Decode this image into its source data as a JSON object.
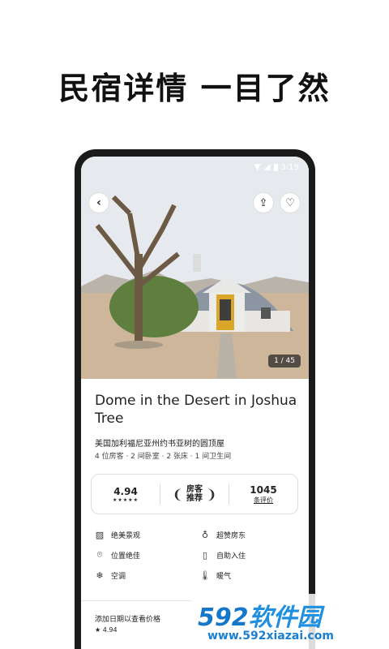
{
  "headline": "民宿详情 一目了然",
  "statusbar": {
    "time": "3:19"
  },
  "photo": {
    "counter": "1 / 45"
  },
  "listing": {
    "title": "Dome in the Desert in Joshua Tree",
    "location": "美国加利福尼亚州约书亚树的圆顶屋",
    "details": "4 位房客 · 2 间卧室 · 2 张床 · 1 间卫生间"
  },
  "stats": {
    "rating": "4.94",
    "stars": "★★★★★",
    "badge_line1": "房客",
    "badge_line2": "推荐",
    "reviews_count": "1045",
    "reviews_label": "条评价"
  },
  "amenities": [
    {
      "label": "绝美景观",
      "icon": "landscape-icon"
    },
    {
      "label": "超赞房东",
      "icon": "superhost-medal-icon"
    },
    {
      "label": "位置绝佳",
      "icon": "location-pin-icon"
    },
    {
      "label": "自助入住",
      "icon": "door-icon"
    },
    {
      "label": "空调",
      "icon": "snowflake-icon"
    },
    {
      "label": "暖气",
      "icon": "thermometer-icon"
    }
  ],
  "booking": {
    "price_hint": "添加日期以查看价格",
    "rating": "★ 4.94"
  },
  "watermark": {
    "logo_num": "592",
    "logo_cn": "软件园",
    "url": "www.592xiazai.com"
  },
  "colors": {
    "watermark_blue": "#1577c9",
    "phone_frame": "#1a1a1a"
  }
}
